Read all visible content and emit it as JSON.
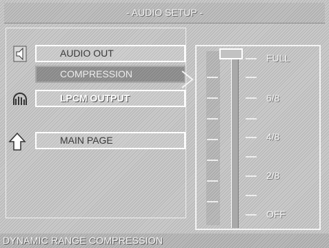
{
  "header": {
    "title": "- AUDIO SETUP -"
  },
  "menu": {
    "items": [
      {
        "label": "AUDIO OUT",
        "icon": "speaker-icon",
        "selected": false
      },
      {
        "label": "COMPRESSION",
        "icon": null,
        "selected": true
      },
      {
        "label": "LPCM OUTPUT",
        "icon": "lpcm-icon",
        "selected": false
      },
      {
        "label": "MAIN PAGE",
        "icon": "up-arrow-icon",
        "selected": false
      }
    ]
  },
  "compression_scale": {
    "levels": [
      "FULL",
      "6/8",
      "4/8",
      "2/8",
      "OFF"
    ],
    "current": "FULL"
  },
  "status": {
    "text": "DYNAMIC RANGE COMPRESSION"
  },
  "colors": {
    "highlight": "#8e8e8e",
    "text_light": "#f4f4f4",
    "background": "#c8c8c8"
  }
}
